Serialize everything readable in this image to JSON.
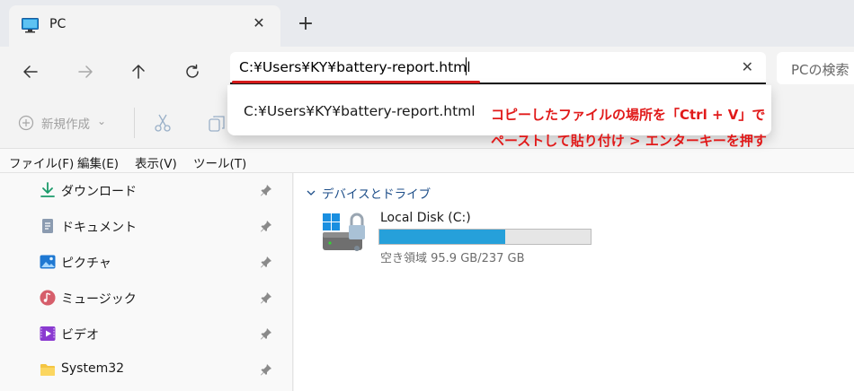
{
  "tab": {
    "title": "PC",
    "close": "✕",
    "new": "+"
  },
  "nav": {
    "back": "back",
    "forward": "forward",
    "up": "up",
    "refresh": "refresh"
  },
  "address": {
    "value": "C:¥Users¥KY¥battery-report.html",
    "clear": "✕"
  },
  "search": {
    "placeholder": "PCの検索"
  },
  "command_bar": {
    "new_label": "新規作成",
    "new_chevron": "⌄"
  },
  "menubar": {
    "items": [
      "ファイル(F)",
      "編集(E)",
      "表示(V)",
      "ツール(T)"
    ]
  },
  "sidebar": {
    "items": [
      {
        "label": "ダウンロード",
        "icon": "download-icon"
      },
      {
        "label": "ドキュメント",
        "icon": "documents-icon"
      },
      {
        "label": "ピクチャ",
        "icon": "pictures-icon"
      },
      {
        "label": "ミュージック",
        "icon": "music-icon"
      },
      {
        "label": "ビデオ",
        "icon": "videos-icon"
      },
      {
        "label": "System32",
        "icon": "folder-icon"
      }
    ]
  },
  "main": {
    "group_label": "デバイスとドライブ",
    "drive": {
      "name": "Local Disk (C:)",
      "space": "空き領域 95.9 GB/237 GB",
      "used_fraction": 0.595
    }
  },
  "dropdown": {
    "suggestion": "C:¥Users¥KY¥battery-report.html"
  },
  "annotation": {
    "line1": "コピーしたファイルの場所を「Ctrl + V」で",
    "line2": "ペーストして貼り付け > エンターキーを押す"
  },
  "colors": {
    "annotation": "#e11a1a",
    "accent": "#26a0da",
    "group_header": "#1d4e89"
  }
}
